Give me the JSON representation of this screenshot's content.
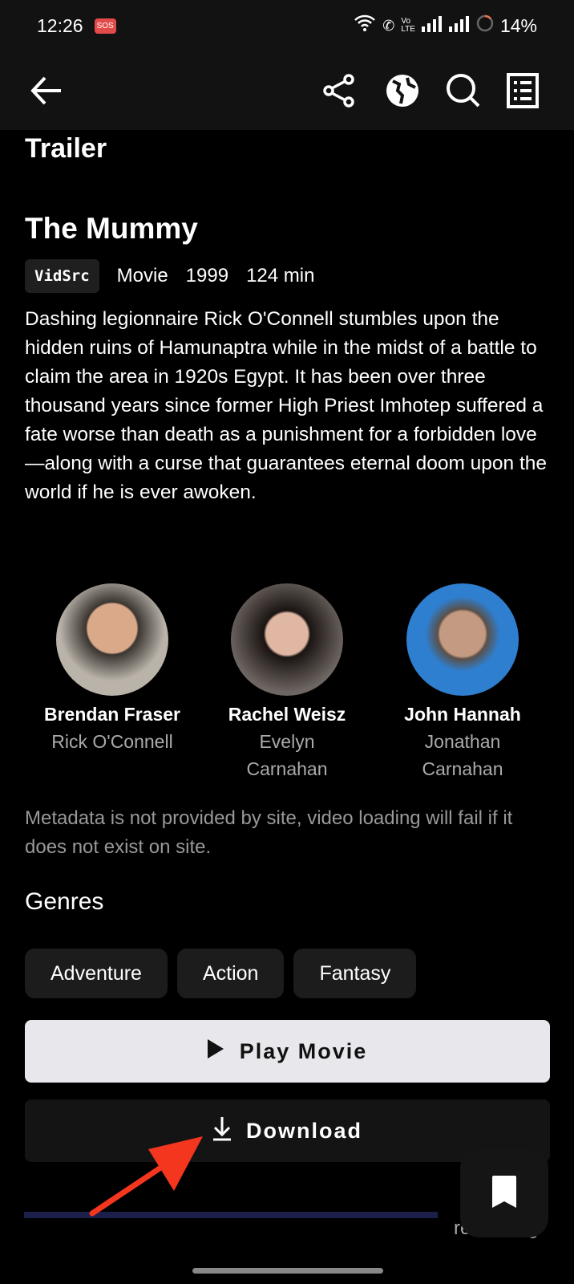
{
  "status_bar": {
    "time": "12:26",
    "sos": "SOS",
    "battery": "14%"
  },
  "app_bar": {
    "icons": [
      "back-arrow-icon",
      "share-icon",
      "globe-icon",
      "search-icon",
      "list-icon"
    ]
  },
  "section": {
    "trailer": "Trailer"
  },
  "movie": {
    "title": "The Mummy",
    "source": "VidSrc",
    "type": "Movie",
    "year": "1999",
    "runtime": "124 min",
    "description": "Dashing legionnaire Rick O'Connell stumbles upon the hidden ruins of Hamunaptra while in the midst of a battle to claim the area in 1920s Egypt. It has been over three thousand years since former High Priest Imhotep suffered a fate worse than death as a punishment for a forbidden love—along with a curse that guarantees eternal doom upon the world if he is ever awoken."
  },
  "cast": [
    {
      "name": "Brendan Fraser",
      "character": "Rick O'Connell"
    },
    {
      "name": "Rachel Weisz",
      "character": "Evelyn Carnahan"
    },
    {
      "name": "John Hannah",
      "character": "Jonathan Carnahan"
    }
  ],
  "note": "Metadata is not provided by site, video loading will fail if it does not exist on site.",
  "genres": {
    "heading": "Genres",
    "items": [
      "Adventure",
      "Action",
      "Fantasy"
    ]
  },
  "actions": {
    "play": "Play Movie",
    "download": "Download"
  },
  "progress": {
    "remaining_label": "remaining"
  },
  "colors": {
    "annotation_arrow": "#f4361f",
    "progress": "#1b1f4a",
    "play_bg": "#e8e8ec"
  }
}
